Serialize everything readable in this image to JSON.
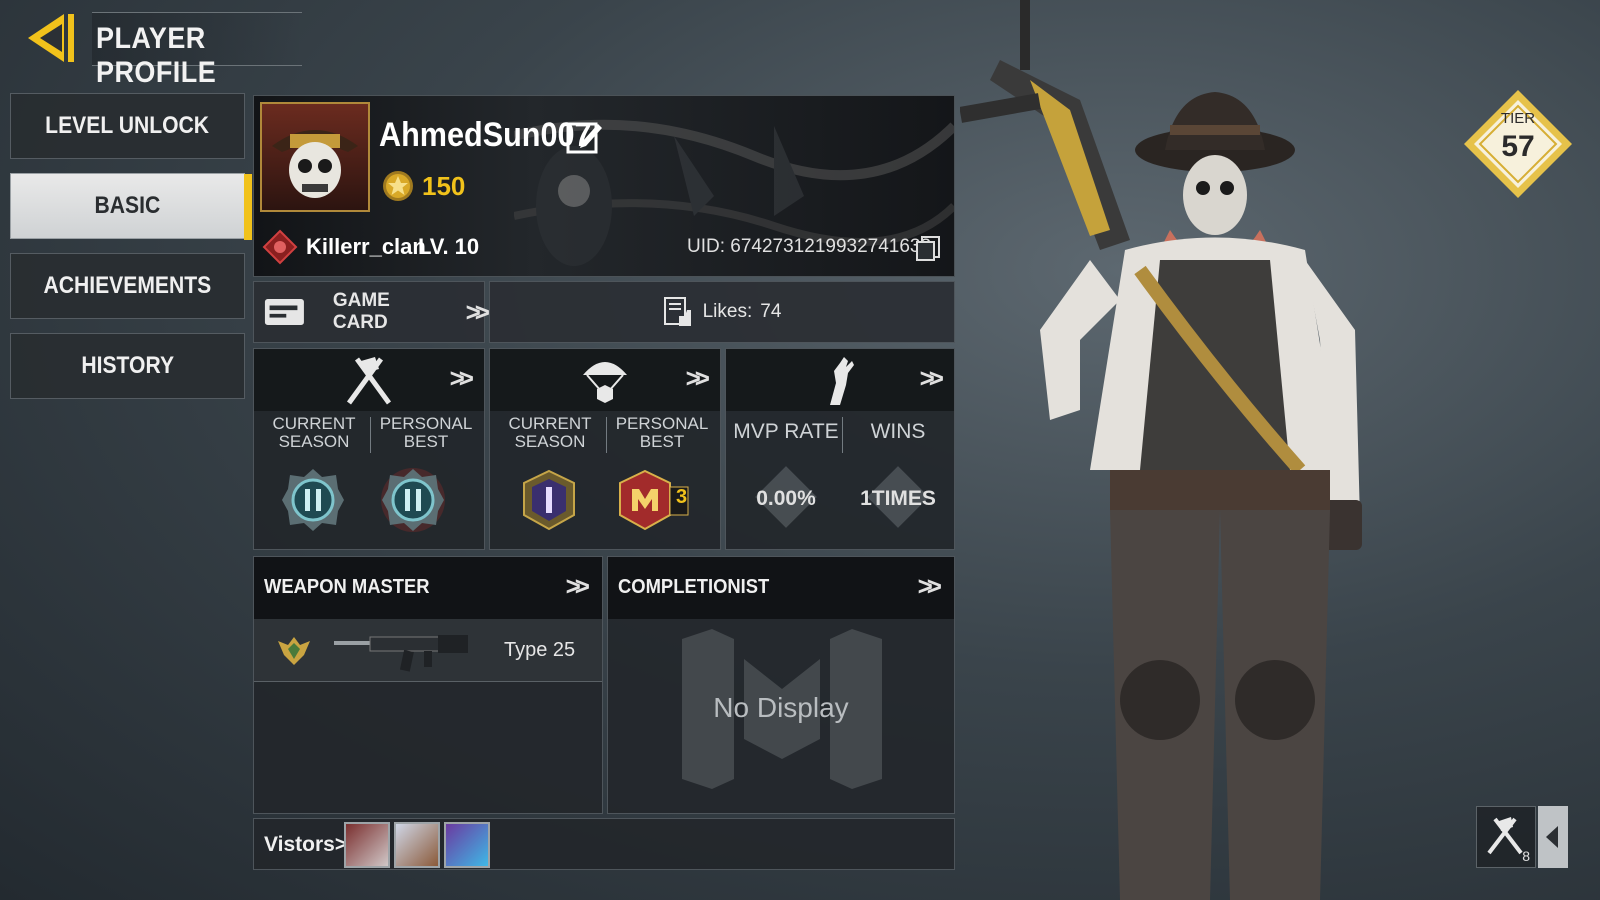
{
  "header": {
    "title": "PLAYER PROFILE"
  },
  "nav": {
    "items": [
      {
        "label": "LEVEL UNLOCK"
      },
      {
        "label": "BASIC"
      },
      {
        "label": "ACHIEVEMENTS"
      },
      {
        "label": "HISTORY"
      }
    ],
    "active_index": 1
  },
  "profile": {
    "name": "AhmedSun007",
    "stars": "150",
    "clan": "Killerr_clan",
    "level": "LV. 10",
    "uid": "UID: 6742731219932741633"
  },
  "game_card": {
    "label": "GAME CARD"
  },
  "likes": {
    "label": "Likes:",
    "count": "74"
  },
  "stats": {
    "panel1": {
      "col1": "CURRENT\nSEASON",
      "col2": "PERSONAL\nBEST"
    },
    "panel2": {
      "col1": "CURRENT\nSEASON",
      "col2": "PERSONAL\nBEST",
      "best_badge_number": "3"
    },
    "panel3": {
      "col1": "MVP RATE",
      "col2": "WINS",
      "mvp_value": "0.00%",
      "wins_value": "1TIMES"
    }
  },
  "weapon_master": {
    "title": "WEAPON MASTER",
    "weapon": "Type 25"
  },
  "completionist": {
    "title": "COMPLETIONIST",
    "empty_text": "No Display"
  },
  "visitors": {
    "label": "Vistors>"
  },
  "tier": {
    "label": "TIER",
    "value": "57"
  },
  "bottom_right": {
    "count": "8"
  },
  "colors": {
    "accent": "#f1c21b",
    "panel": "#22262a",
    "text": "#e8e8e8"
  },
  "icons": [
    "back-arrow-icon",
    "edit-icon",
    "star-icon",
    "clan-icon",
    "copy-icon",
    "game-card-icon",
    "likes-icon",
    "multiplayer-icon",
    "battle-royale-icon",
    "zombies-icon",
    "chevron-double-icon",
    "rank-badge-icon",
    "weapon-icon",
    "tier-icon"
  ]
}
